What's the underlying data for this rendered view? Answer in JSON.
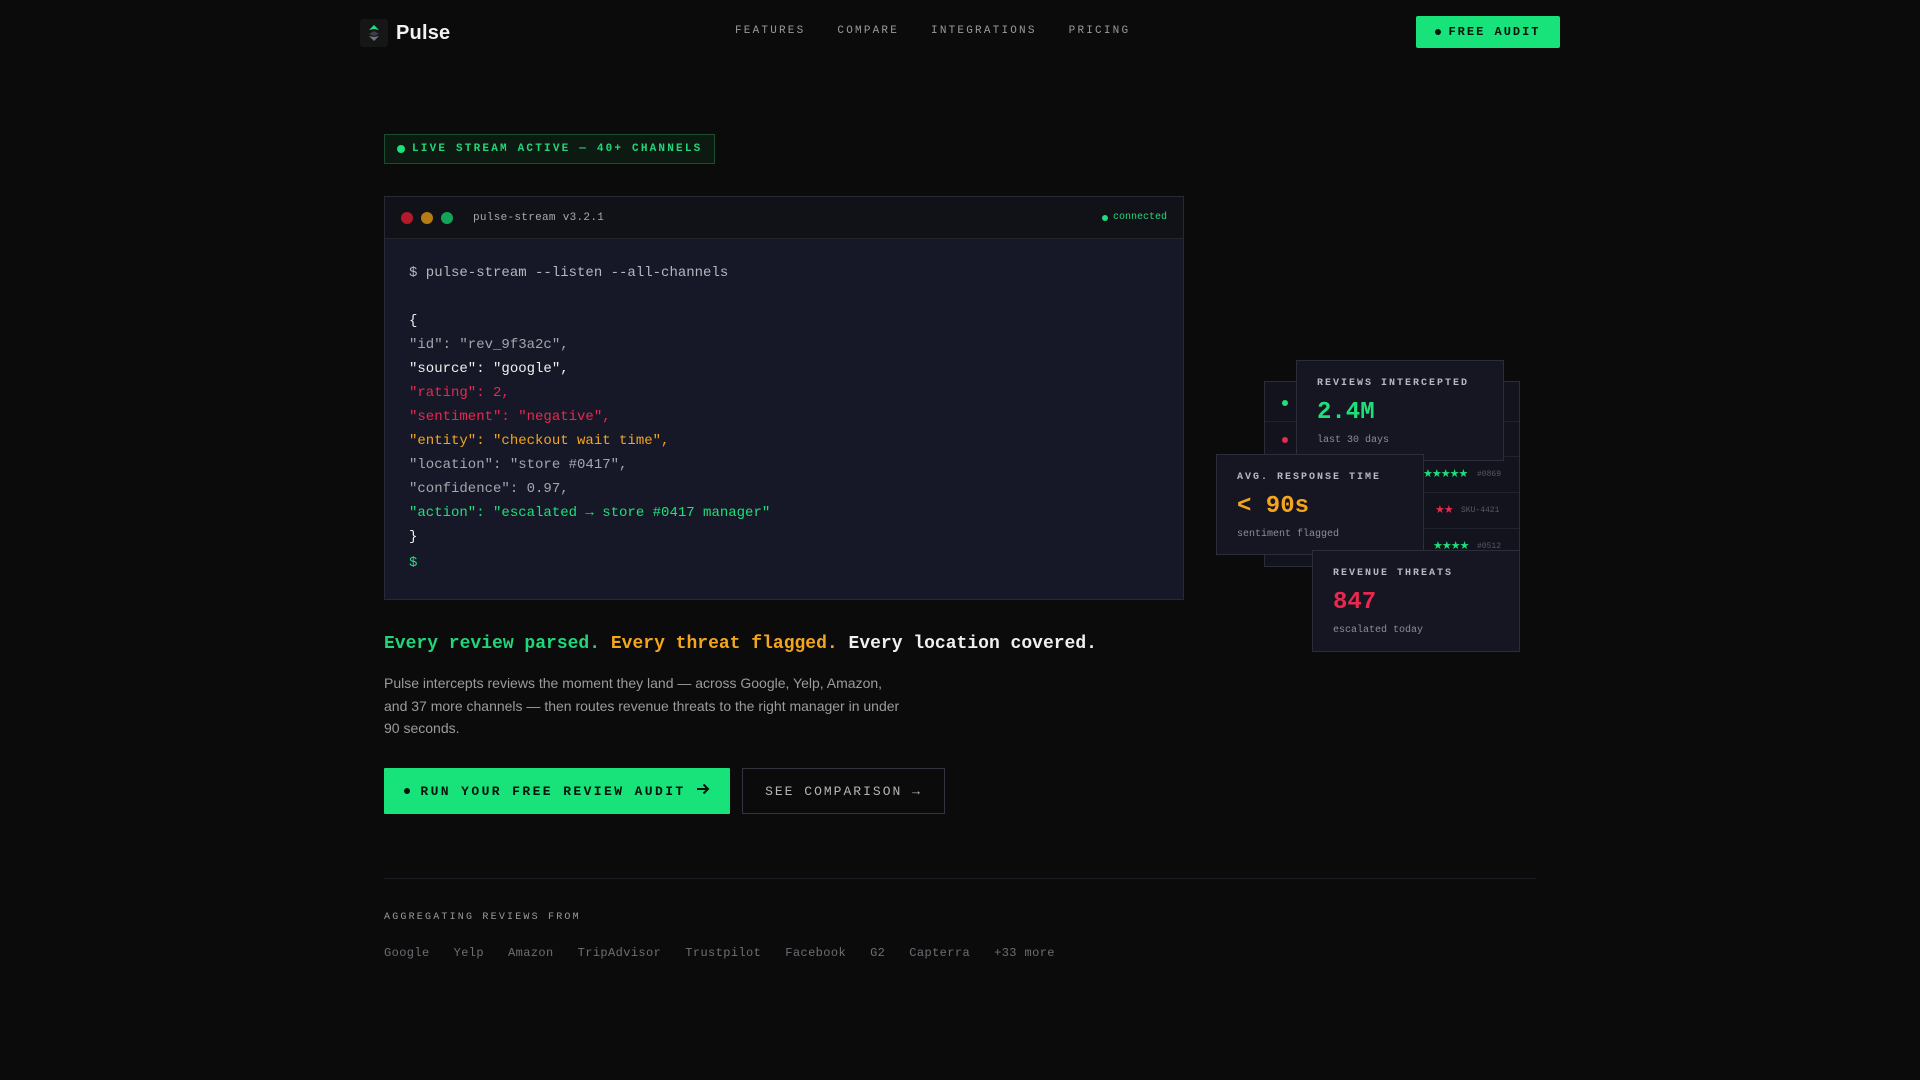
{
  "nav": {
    "brand": "Pulse",
    "links": [
      "FEATURES",
      "COMPARE",
      "INTEGRATIONS",
      "PRICING"
    ],
    "cta": "FREE AUDIT"
  },
  "badge": "LIVE STREAM ACTIVE — 40+ CHANNELS",
  "terminal": {
    "title": "pulse-stream v3.2.1",
    "status": "connected",
    "command": "$ pulse-stream --listen --all-channels",
    "lines": {
      "open": "{",
      "id": "\"id\": \"rev_9f3a2c\",",
      "source": "\"source\": \"google\",",
      "rating": "\"rating\": 2,",
      "sentiment": "\"sentiment\": \"negative\",",
      "entity": "\"entity\": \"checkout wait time\",",
      "location": "\"location\": \"store #0417\",",
      "confidence": "\"confidence\": 0.97,",
      "action": "\"action\": \"escalated → store #0417 manager\"",
      "close": "}"
    },
    "prompt": "$"
  },
  "hero": {
    "headline_1": "Every review parsed.",
    "headline_2": "Every threat flagged.",
    "headline_3": "Every location covered.",
    "lead": "Pulse intercepts reviews the moment they land — across Google, Yelp, Amazon, and 37 more channels — then routes revenue threats to the right manager in under 90 seconds.",
    "cta_primary": "RUN YOUR FREE REVIEW AUDIT",
    "cta_secondary": "SEE COMPARISON →"
  },
  "channels": {
    "label": "AGGREGATING REVIEWS FROM",
    "items": [
      "Google",
      "Yelp",
      "Amazon",
      "TripAdvisor",
      "Trustpilot",
      "Facebook",
      "G2",
      "Capterra",
      "+33 more"
    ]
  },
  "feed": {
    "rows": [
      {
        "stars": "★★★★★",
        "store": "#0869",
        "color": "#1ee07b"
      },
      {
        "stars": "★★",
        "store": "SKU-4421",
        "color": "#e8284e"
      },
      {
        "stars": "★★★★",
        "store": "#0512",
        "color": "#1ee07b"
      }
    ]
  },
  "stats": {
    "reviews": {
      "label": "REVIEWS INTERCEPTED",
      "value": "2.4M",
      "sub": "last 30 days"
    },
    "response": {
      "label": "AVG. RESPONSE TIME",
      "value": "< 90s",
      "sub": "sentiment flagged"
    },
    "threats": {
      "label": "REVENUE THREATS",
      "value": "847",
      "sub": "escalated today"
    }
  },
  "colors": {
    "accent_green": "#18e27a",
    "amber": "#f3a51e",
    "red": "#e8284e",
    "background": "#0b0b0c"
  },
  "icons": {
    "logo": "pulse-logo-icon",
    "cta_arrow": "arrow-right-icon"
  }
}
